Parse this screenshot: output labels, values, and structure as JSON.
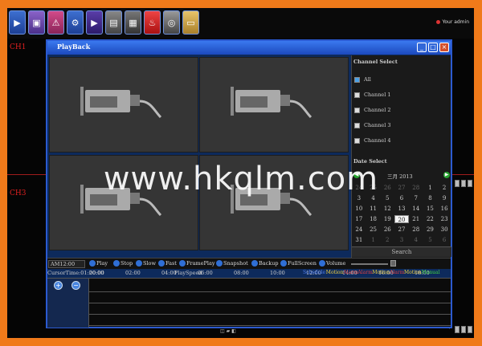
{
  "toolbar_icons": [
    "arrow-right-icon",
    "image-icon",
    "alarm-icon",
    "gear-icon",
    "play-icon",
    "record-icon",
    "film-icon",
    "fire-icon",
    "hdd-icon",
    "notepad-icon"
  ],
  "user": "Your admin",
  "bg_labels": {
    "ch1": "CH1",
    "ch3": "CH3"
  },
  "window": {
    "title": "PlayBack"
  },
  "channel_select": {
    "title": "Channel Select",
    "items": [
      {
        "label": "All",
        "checked": true
      },
      {
        "label": "Channel 1",
        "checked": false
      },
      {
        "label": "Channel 2",
        "checked": false
      },
      {
        "label": "Channel 3",
        "checked": false
      },
      {
        "label": "Channel 4",
        "checked": false
      }
    ]
  },
  "date_select": {
    "title": "Date Select",
    "month": "三月",
    "year": "2013",
    "days": [
      {
        "d": "24",
        "dim": true
      },
      {
        "d": "25",
        "dim": true
      },
      {
        "d": "26",
        "dim": true
      },
      {
        "d": "27",
        "dim": true
      },
      {
        "d": "28",
        "dim": true
      },
      {
        "d": "1"
      },
      {
        "d": "2"
      },
      {
        "d": "3"
      },
      {
        "d": "4"
      },
      {
        "d": "5"
      },
      {
        "d": "6"
      },
      {
        "d": "7"
      },
      {
        "d": "8"
      },
      {
        "d": "9"
      },
      {
        "d": "10"
      },
      {
        "d": "11"
      },
      {
        "d": "12"
      },
      {
        "d": "13"
      },
      {
        "d": "14"
      },
      {
        "d": "15"
      },
      {
        "d": "16"
      },
      {
        "d": "17"
      },
      {
        "d": "18"
      },
      {
        "d": "19"
      },
      {
        "d": "20",
        "selected": true
      },
      {
        "d": "21"
      },
      {
        "d": "22"
      },
      {
        "d": "23"
      },
      {
        "d": "24"
      },
      {
        "d": "25"
      },
      {
        "d": "26"
      },
      {
        "d": "27"
      },
      {
        "d": "28"
      },
      {
        "d": "29"
      },
      {
        "d": "30"
      },
      {
        "d": "31"
      },
      {
        "d": "1",
        "dim": true
      },
      {
        "d": "2",
        "dim": true
      },
      {
        "d": "3",
        "dim": true
      },
      {
        "d": "4",
        "dim": true
      },
      {
        "d": "5",
        "dim": true
      },
      {
        "d": "6",
        "dim": true
      }
    ],
    "search_label": "Search"
  },
  "controls": {
    "time": "AM12:00",
    "play": "Play",
    "stop": "Stop",
    "slow": "Slow",
    "fast": "Fast",
    "frame": "FramePlay",
    "snapshot": "Snapshot",
    "backup": "Backup",
    "fullscreen": "FullScreen",
    "volume": "Volume"
  },
  "timeline": {
    "cursor_time": "CursorTime:01:20:00",
    "play_speed": "PlaySpeed",
    "ticks": [
      "00:00",
      "02:00",
      "04:00",
      "06:00",
      "08:00",
      "10:00",
      "12:00",
      "14:00",
      "16:00",
      "18:00"
    ],
    "legend": [
      {
        "label": "Schedule",
        "color": "#4f7df0"
      },
      {
        "label": "Motion",
        "color": "#f0d040"
      },
      {
        "label": "Alarm",
        "color": "#e04040"
      },
      {
        "label": "Alarm",
        "color": "#e04040"
      },
      {
        "label": "Motion",
        "color": "#f0d040"
      },
      {
        "label": "Alarm",
        "color": "#e04040"
      },
      {
        "label": "Motion",
        "color": "#f0d040"
      },
      {
        "label": "Manual",
        "color": "#40d040"
      }
    ]
  },
  "watermark": "www.hkqlm.com"
}
